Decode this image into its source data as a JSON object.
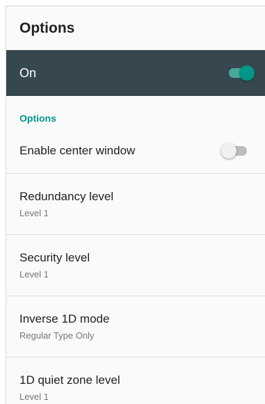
{
  "app_bar": {
    "title": "Options"
  },
  "master_switch": {
    "label": "On",
    "state": true
  },
  "category": {
    "title": "Options"
  },
  "enable_center_window": {
    "title": "Enable center window",
    "state": false
  },
  "preferences": [
    {
      "title": "Redundancy level",
      "summary": "Level 1"
    },
    {
      "title": "Security level",
      "summary": "Level 1"
    },
    {
      "title": "Inverse 1D mode",
      "summary": "Regular Type Only"
    },
    {
      "title": "1D quiet zone level",
      "summary": "Level 1"
    }
  ],
  "colors": {
    "accent": "#009688",
    "switch_bar": "#37474f",
    "switch_off_track": "#bdbdbd"
  }
}
